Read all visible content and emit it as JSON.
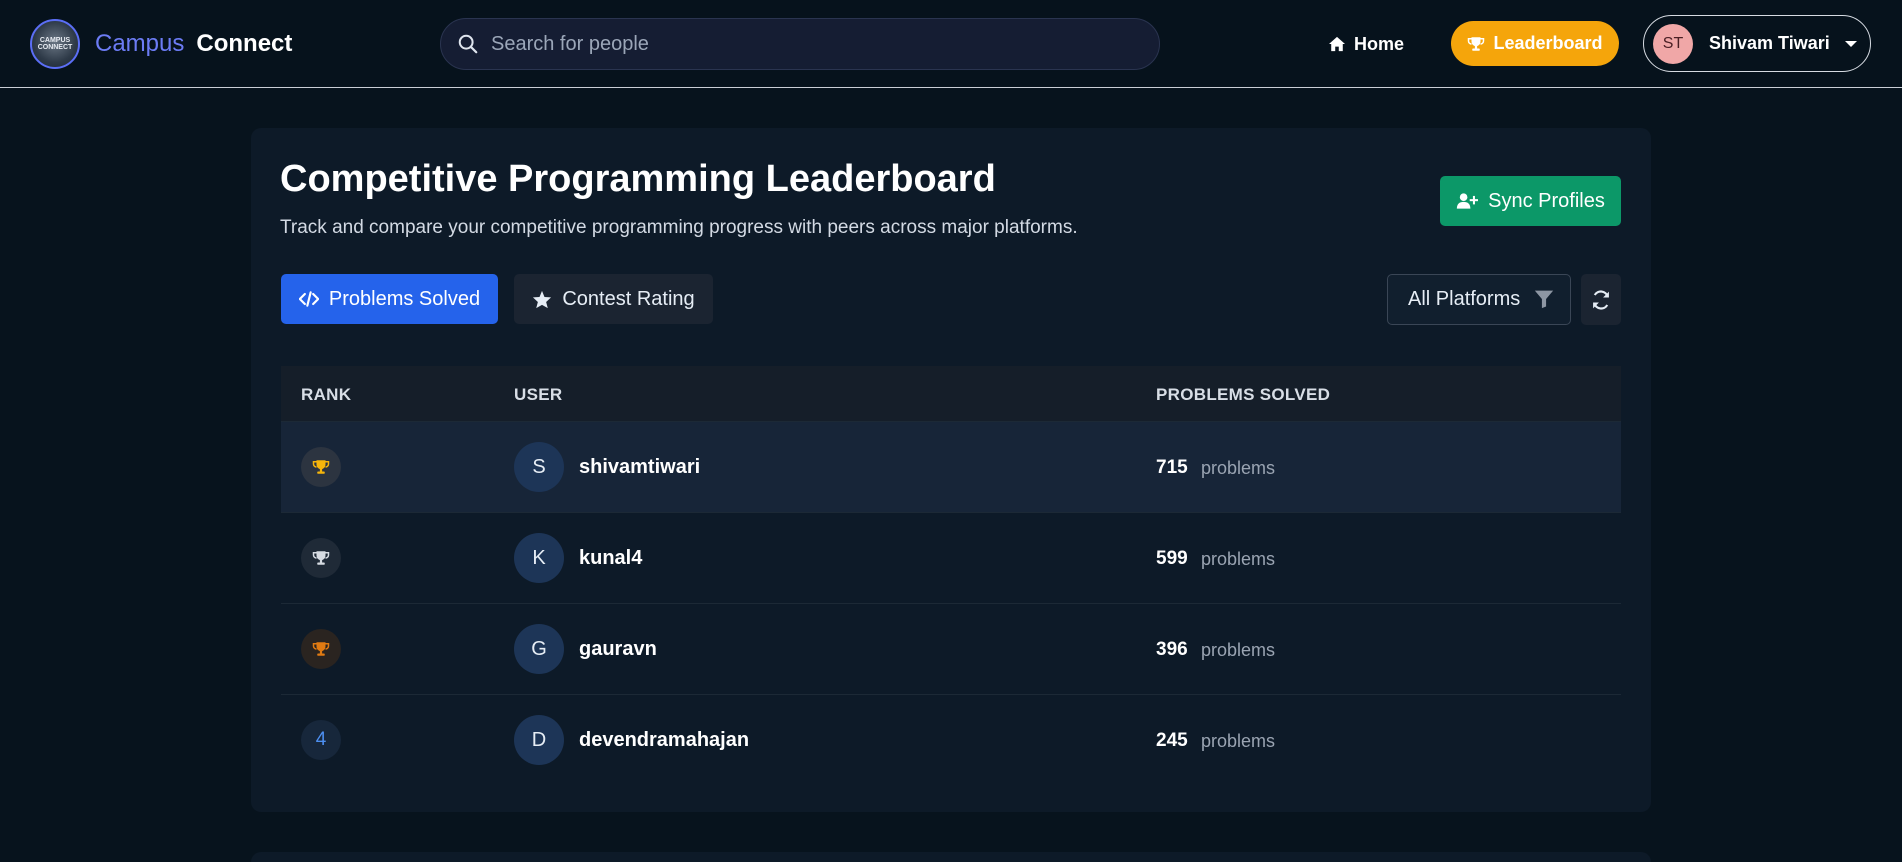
{
  "navbar": {
    "logo_text": "CAMPUS CONNECT",
    "brand_first": "Campus",
    "brand_second": "Connect",
    "search_placeholder": "Search for people",
    "home_label": "Home",
    "leaderboard_label": "Leaderboard",
    "user_initials": "ST",
    "user_name": "Shivam Tiwari"
  },
  "page": {
    "title": "Competitive Programming Leaderboard",
    "subtitle": "Track and compare your competitive programming progress with peers across major platforms.",
    "sync_label": "Sync Profiles"
  },
  "tabs": [
    {
      "label": "Problems Solved",
      "active": true
    },
    {
      "label": "Contest Rating",
      "active": false
    }
  ],
  "filter": {
    "selected": "All Platforms"
  },
  "table": {
    "headers": [
      "RANK",
      "USER",
      "PROBLEMS SOLVED"
    ],
    "rows": [
      {
        "rank": "1",
        "medal": "gold",
        "initial": "S",
        "username": "shivamtiwari",
        "count": "715",
        "unit": "problems"
      },
      {
        "rank": "2",
        "medal": "silver",
        "initial": "K",
        "username": "kunal4",
        "count": "599",
        "unit": "problems"
      },
      {
        "rank": "3",
        "medal": "bronze",
        "initial": "G",
        "username": "gauravn",
        "count": "396",
        "unit": "problems"
      },
      {
        "rank": "4",
        "medal": "none",
        "initial": "D",
        "username": "devendramahajan",
        "count": "245",
        "unit": "problems"
      }
    ]
  },
  "colors": {
    "gold": "#f5b50b",
    "silver": "#d6dbe2",
    "bronze": "#e07a12",
    "accent": "#2563eb",
    "success": "#0c9868",
    "warning": "#f5a50b"
  }
}
